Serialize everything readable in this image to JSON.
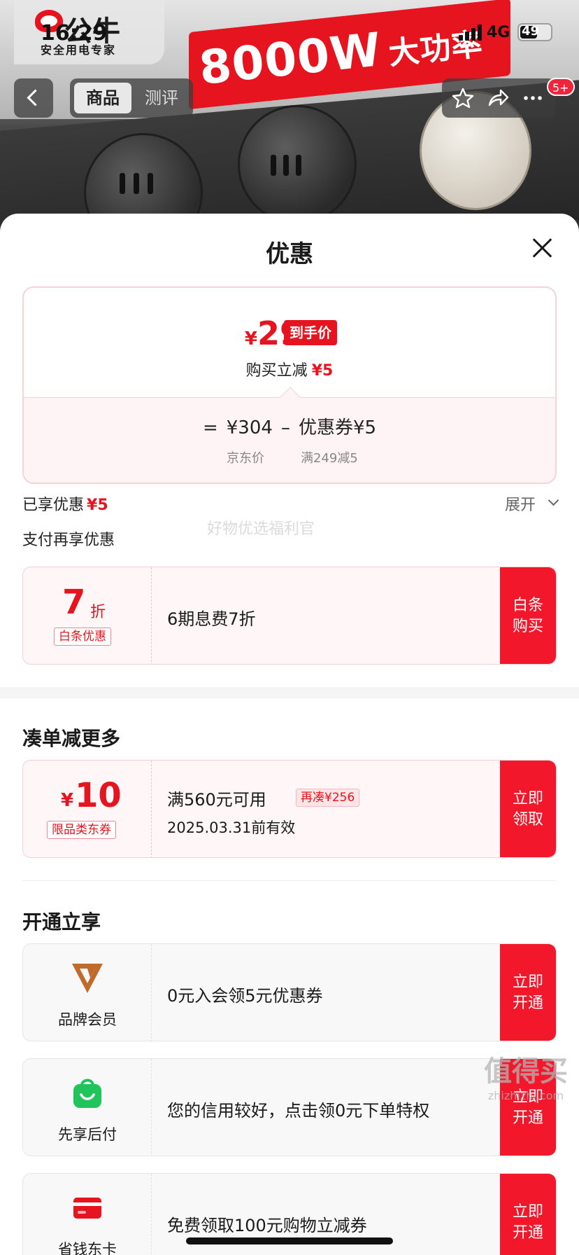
{
  "status_bar": {
    "time": "16:29",
    "network": "4G",
    "battery": "49"
  },
  "hero": {
    "brand_name": "公牛",
    "brand_slogan": "安全用电专家",
    "banner_text": "8000W",
    "banner_suffix": "大功率"
  },
  "nav": {
    "tabs": [
      {
        "label": "商品",
        "active": true
      },
      {
        "label": "测评",
        "active": false
      }
    ],
    "message_badge": "5+"
  },
  "sheet": {
    "title": "优惠",
    "price": {
      "currency": "¥",
      "final": "299",
      "final_tag": "到手价",
      "reduce_label": "购买立减",
      "reduce_amount": "¥5",
      "eq": "=",
      "base": "¥304",
      "minus": "–",
      "coupon_label": "优惠券¥5",
      "base_desc": "京东价",
      "coupon_desc": "满249减5"
    },
    "enjoyed_label": "已享优惠",
    "enjoyed_amount": "¥5",
    "expand_label": "展开",
    "pay_more_label": "支付再享优惠",
    "watermark": "好物优选福利官",
    "baitiao": {
      "discount": "7",
      "unit": "折",
      "tag": "白条优惠",
      "text": "6期息费7折",
      "action": "白条购买"
    },
    "section_more": "凑单减更多",
    "coupon": {
      "currency": "¥",
      "amount": "10",
      "tag": "限品类东券",
      "condition": "满560元可用",
      "extra": "再凑¥256",
      "validity": "2025.03.31前有效",
      "action": "立即领取"
    },
    "section_open": "开通立享",
    "memberships": [
      {
        "icon": "brand-v-icon",
        "label": "品牌会员",
        "text": "0元入会领5元优惠券",
        "action": "立即开通",
        "accent": "#b5652a"
      },
      {
        "icon": "shopping-bag-icon",
        "label": "先享后付",
        "text": "您的信用较好，点击领0元下单特权",
        "action": "立即开通",
        "accent": "#1fc45a"
      },
      {
        "icon": "card-icon",
        "label": "省钱东卡",
        "text": "免费领取100元购物立减券",
        "action": "立即开通",
        "accent": "#e5141e"
      }
    ]
  },
  "site_watermark": {
    "main": "值得买",
    "sub": "zhizhizhi.com"
  },
  "colors": {
    "accent": "#e5141e",
    "action_bg": "#f2172a"
  }
}
